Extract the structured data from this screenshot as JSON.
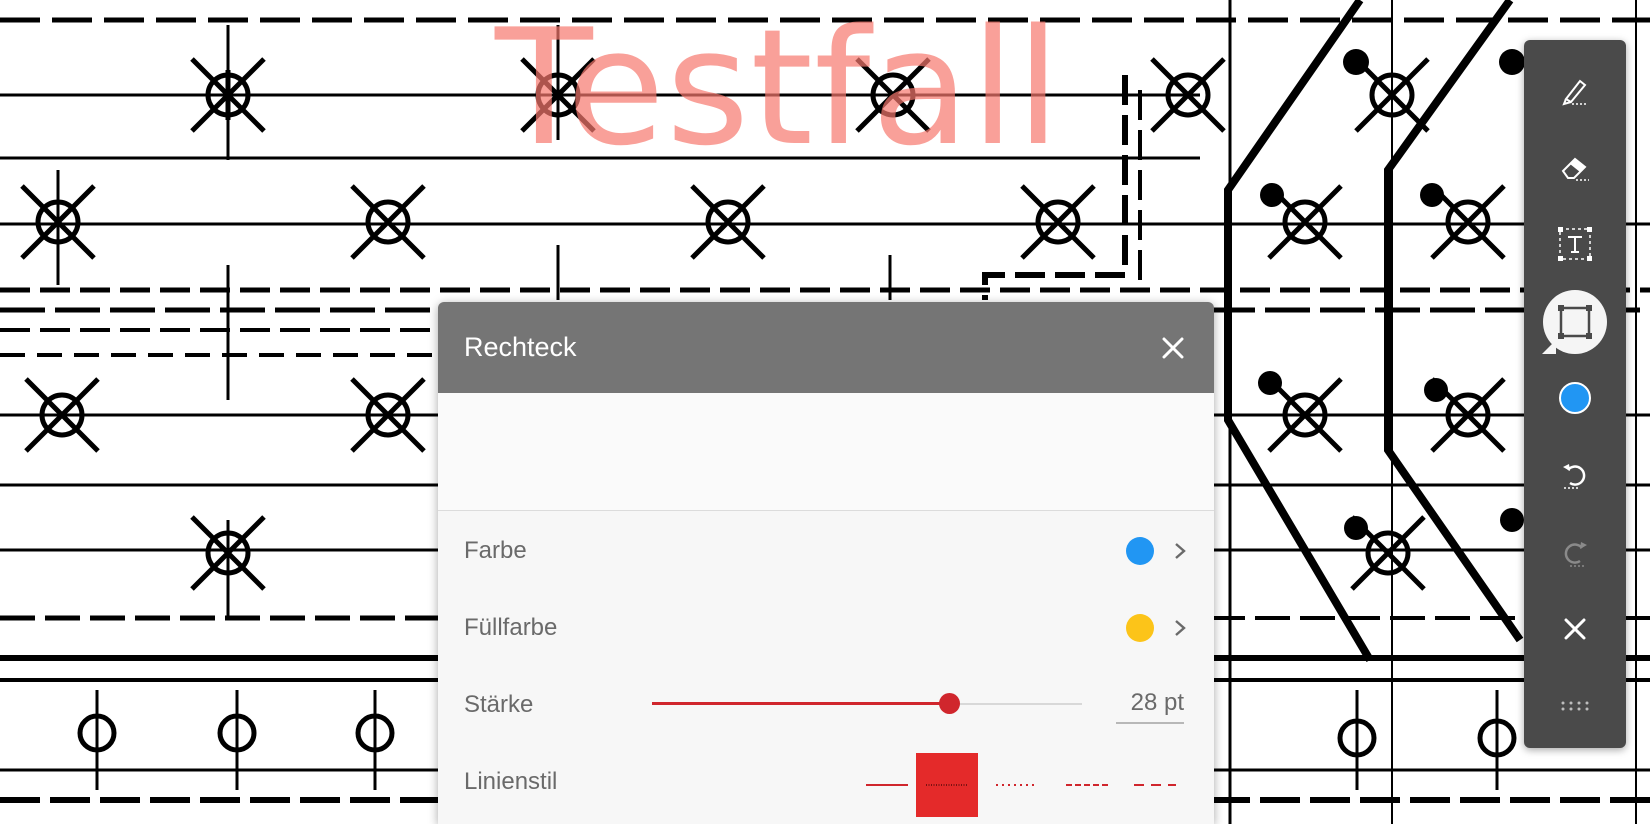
{
  "watermark": "Testfall",
  "dialog": {
    "title": "Rechteck",
    "close_label": "close",
    "rows": {
      "color": {
        "label": "Farbe",
        "swatch": "#2196f3"
      },
      "fill": {
        "label": "Füllfarbe",
        "swatch": "#fcc419"
      },
      "thickness": {
        "label": "Stärke",
        "value_text": "28 pt",
        "level_fraction": 0.69
      },
      "line_style": {
        "label": "Linienstil",
        "options": [
          "solid",
          "dotted-fine",
          "dotted",
          "dashed-short",
          "dashed-long"
        ],
        "selected": "dotted-fine"
      }
    },
    "preview": {
      "fill": "#fcda63",
      "border": "#6cb4e6"
    },
    "accent": "#d0262d"
  },
  "toolbar": {
    "tools": [
      {
        "name": "pen-icon",
        "active": false
      },
      {
        "name": "eraser-icon",
        "active": false
      },
      {
        "name": "text-box-icon",
        "active": false
      },
      {
        "name": "rectangle-icon",
        "active": true
      },
      {
        "name": "color-dot-icon",
        "active": false,
        "color": "#2196f3"
      },
      {
        "name": "undo-icon",
        "active": false
      },
      {
        "name": "redo-icon",
        "active": false,
        "disabled": true
      },
      {
        "name": "close-icon",
        "active": false
      },
      {
        "name": "drag-handle-icon",
        "active": false
      }
    ]
  }
}
